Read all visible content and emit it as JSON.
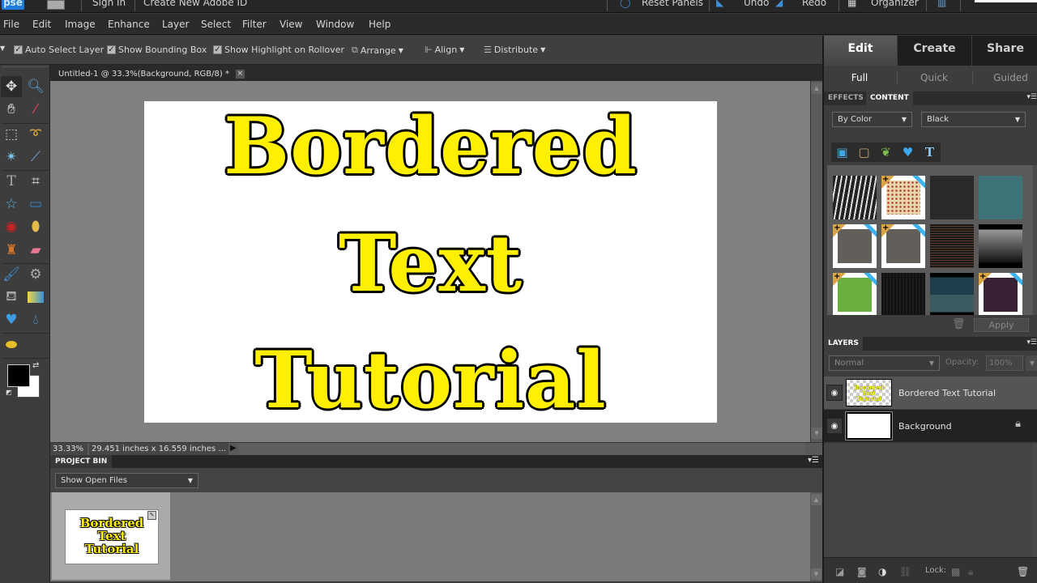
{
  "app": {
    "logo": "pse",
    "topbar": {
      "sign_in": "Sign In",
      "create_id": "Create New Adobe ID",
      "reset_panels": "Reset Panels",
      "undo": "Undo",
      "redo": "Redo",
      "organizer": "Organizer"
    }
  },
  "menu": [
    "File",
    "Edit",
    "Image",
    "Enhance",
    "Layer",
    "Select",
    "Filter",
    "View",
    "Window",
    "Help"
  ],
  "options": {
    "auto_select_layer": {
      "label": "Auto Select Layer",
      "checked": true
    },
    "show_bounding_box": {
      "label": "Show Bounding Box",
      "checked": true
    },
    "show_highlight": {
      "label": "Show Highlight on Rollover",
      "checked": true
    },
    "arrange": "Arrange",
    "align": "Align",
    "distribute": "Distribute"
  },
  "document": {
    "tab_title": "Untitled-1 @ 33.3%(Background, RGB/8) *",
    "close": "×",
    "lines": [
      "Bordered",
      "Text",
      "Tutorial"
    ],
    "text_color": "#ffef00",
    "stroke_color": "#000000"
  },
  "status": {
    "zoom": "33.33%",
    "dimensions": "29.451 inches x 16.559 inches ..."
  },
  "project_bin": {
    "title": "PROJECT BIN",
    "filter": "Show Open Files",
    "thumb_lines": [
      "Bordered",
      "Text",
      "Tutorial"
    ]
  },
  "right_panel": {
    "modes": [
      "Edit",
      "Create",
      "Share"
    ],
    "active_mode": "Edit",
    "submodes": [
      "Full",
      "Quick",
      "Guided"
    ],
    "active_submode": "Full",
    "tabs": [
      "EFFECTS",
      "CONTENT"
    ],
    "active_tab": "CONTENT",
    "sort_by": "By Color",
    "color_filter": "Black",
    "content_types": [
      "backgrounds-icon",
      "frames-icon",
      "graphics-icon",
      "shapes-icon",
      "text-effects-icon"
    ],
    "apply": "Apply",
    "swatches": [
      {
        "name": "zebra-stripes",
        "premium": false
      },
      {
        "name": "dotted-beige",
        "premium": true
      },
      {
        "name": "dark-texture",
        "premium": false
      },
      {
        "name": "teal-texture",
        "premium": false
      },
      {
        "name": "gray-frame",
        "premium": true
      },
      {
        "name": "tilted-gray-paper",
        "premium": true
      },
      {
        "name": "brown-plaid",
        "premium": false
      },
      {
        "name": "gray-gradient",
        "premium": false
      },
      {
        "name": "green-paper",
        "premium": true
      },
      {
        "name": "black-stripes",
        "premium": false
      },
      {
        "name": "dark-teal-drips",
        "premium": false
      },
      {
        "name": "purple-texture",
        "premium": true
      }
    ]
  },
  "layers": {
    "title": "LAYERS",
    "blend_mode": "Normal",
    "opacity_label": "Opacity:",
    "opacity_value": "100%",
    "items": [
      {
        "name": "Bordered Text Tutorial",
        "visible": true,
        "locked": false,
        "selected": false
      },
      {
        "name": "Background",
        "visible": true,
        "locked": true,
        "selected": true
      }
    ],
    "lock_label": "Lock:"
  }
}
